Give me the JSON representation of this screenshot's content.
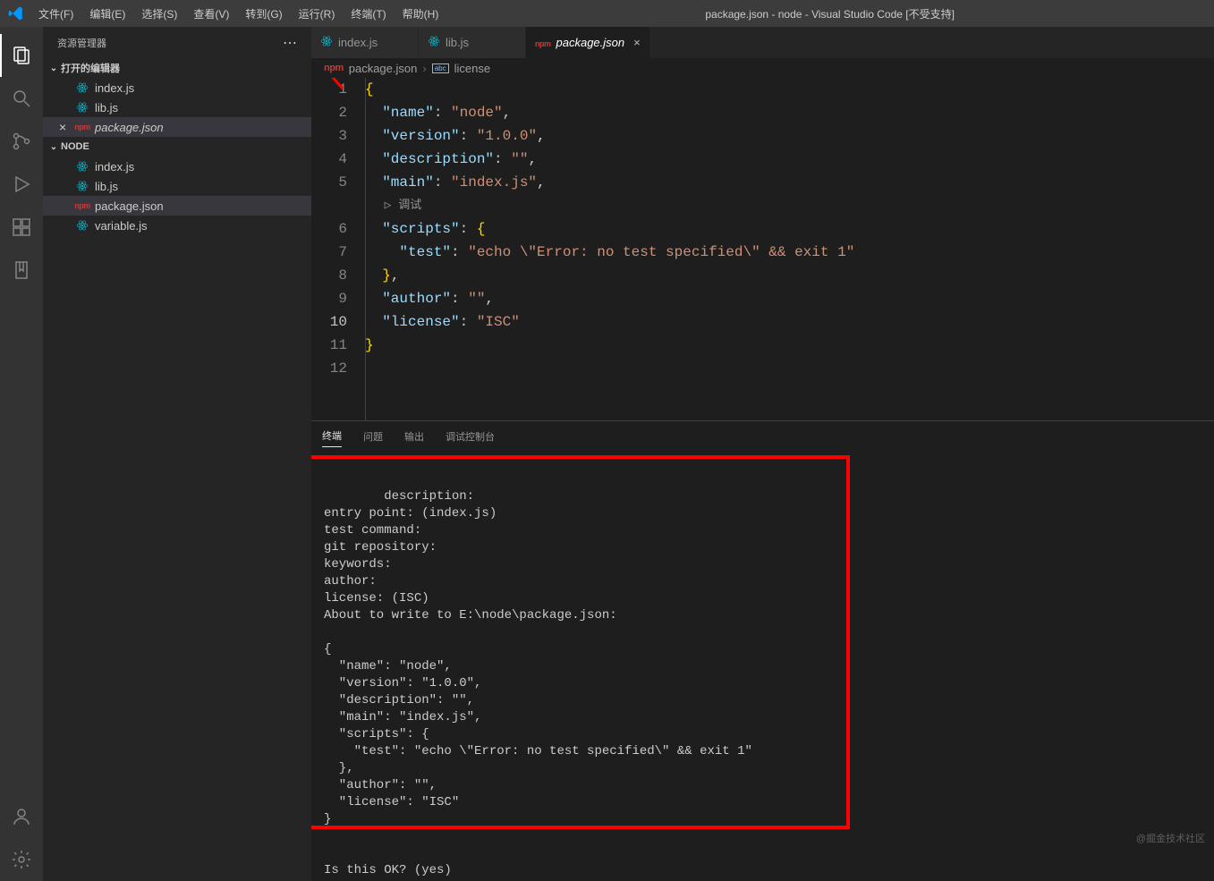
{
  "titlebar": {
    "menus": [
      "文件(F)",
      "编辑(E)",
      "选择(S)",
      "查看(V)",
      "转到(G)",
      "运行(R)",
      "终端(T)",
      "帮助(H)"
    ],
    "title": "package.json - node - Visual Studio Code [不受支持]"
  },
  "sidebar": {
    "title": "资源管理器",
    "sections": {
      "openEditors": {
        "label": "打开的编辑器",
        "items": [
          {
            "icon": "react",
            "label": "index.js",
            "active": false
          },
          {
            "icon": "react",
            "label": "lib.js",
            "active": false
          },
          {
            "icon": "npm",
            "label": "package.json",
            "active": true,
            "italic": true,
            "close": "×"
          }
        ]
      },
      "folder": {
        "label": "NODE",
        "items": [
          {
            "icon": "react",
            "label": "index.js"
          },
          {
            "icon": "react",
            "label": "lib.js"
          },
          {
            "icon": "npm",
            "label": "package.json",
            "active": true
          },
          {
            "icon": "react",
            "label": "variable.js"
          }
        ]
      }
    }
  },
  "tabs": [
    {
      "icon": "react",
      "label": "index.js",
      "active": false
    },
    {
      "icon": "react",
      "label": "lib.js",
      "active": false
    },
    {
      "icon": "npm",
      "label": "package.json",
      "active": true,
      "italic": true
    }
  ],
  "breadcrumbs": {
    "file": "package.json",
    "symbol": "license"
  },
  "editor": {
    "currentLine": 10,
    "debugLens": "▷ 调试",
    "lines": [
      {
        "n": 1,
        "t": "{",
        "cls": "brace"
      },
      {
        "n": 2,
        "k": "name",
        "v": "node",
        "comma": true
      },
      {
        "n": 3,
        "k": "version",
        "v": "1.0.0",
        "comma": true
      },
      {
        "n": 4,
        "k": "description",
        "v": "",
        "comma": true
      },
      {
        "n": 5,
        "k": "main",
        "v": "index.js",
        "comma": true
      },
      {
        "n": 6,
        "k": "scripts",
        "open": true
      },
      {
        "n": 7,
        "k2": "test",
        "v": "echo \\\"Error: no test specified\\\" && exit 1"
      },
      {
        "n": 8,
        "closeObj": true,
        "comma": true
      },
      {
        "n": 9,
        "k": "author",
        "v": "",
        "comma": true
      },
      {
        "n": 10,
        "k": "license",
        "v": "ISC"
      },
      {
        "n": 11,
        "t": "}",
        "cls": "brace"
      },
      {
        "n": 12,
        "t": ""
      }
    ]
  },
  "panel": {
    "tabs": [
      "终端",
      "问题",
      "输出",
      "调试控制台"
    ],
    "activeTab": 0,
    "terminalText": "description:\nentry point: (index.js)\ntest command:\ngit repository:\nkeywords:\nauthor:\nlicense: (ISC)\nAbout to write to E:\\node\\package.json:\n\n{\n  \"name\": \"node\",\n  \"version\": \"1.0.0\",\n  \"description\": \"\",\n  \"main\": \"index.js\",\n  \"scripts\": {\n    \"test\": \"echo \\\"Error: no test specified\\\" && exit 1\"\n  },\n  \"author\": \"\",\n  \"license\": \"ISC\"\n}\n\n\nIs this OK? (yes)"
  },
  "watermark": "@掘金技术社区"
}
